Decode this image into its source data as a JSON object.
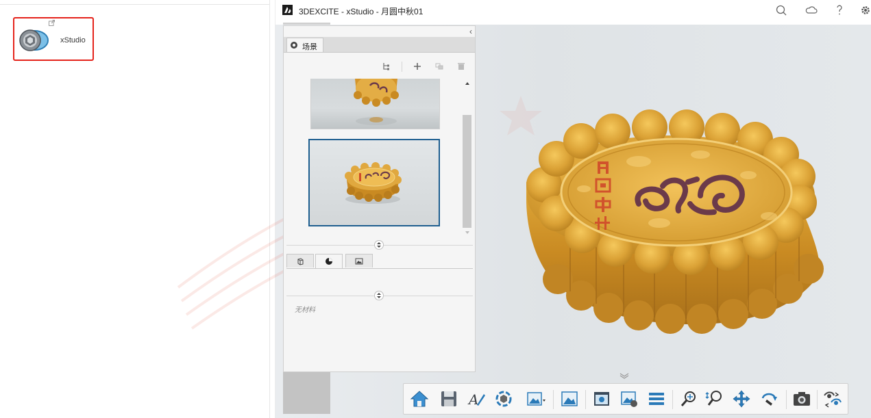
{
  "launcher": {
    "app_name": "xStudio"
  },
  "window": {
    "title": "3DEXCITE - xStudio - 月圆中秋01"
  },
  "scene_panel": {
    "tab_label": "场景",
    "no_material_label": "无材料"
  },
  "colors": {
    "highlight_border": "#e5231b",
    "selected_thumb_border": "#1d5e8f",
    "toolbar_icon_blue": "#2a7ab8",
    "mooncake_gold": "#d79a2a"
  },
  "icons": {
    "titlebar": [
      "search-icon",
      "cloud-icon",
      "help-icon",
      "settings-icon"
    ],
    "scene_tools": [
      "hierarchy-icon",
      "add-icon",
      "duplicate-icon",
      "delete-icon"
    ],
    "property_tabs": [
      "object-tab-icon",
      "material-tab-icon",
      "environment-tab-icon"
    ],
    "toolbar": [
      "home-icon",
      "save-icon",
      "style-icon",
      "render-icon",
      "image-view-icon",
      "picture-icon",
      "display-icon",
      "scene-edit-icon",
      "list-icon",
      "zoom-icon",
      "zoom-area-icon",
      "pan-icon",
      "rotate-icon",
      "camera-icon",
      "view-sync-icon"
    ]
  }
}
